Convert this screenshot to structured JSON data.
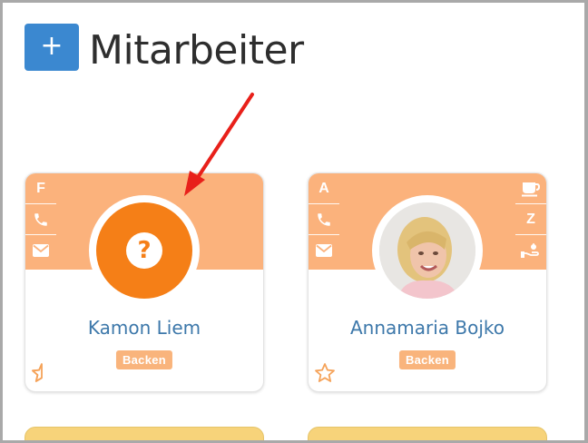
{
  "header": {
    "add_label": "+",
    "title": "Mitarbeiter"
  },
  "colors": {
    "accent_blue": "#3b88d0",
    "card_header": "#fbb27c",
    "avatar_unknown": "#f57f17",
    "badge": "#f9b47c",
    "name": "#3d78aa",
    "annotation_arrow": "#e8201a"
  },
  "employees": [
    {
      "name": "Kamon Liem",
      "department": "Backen",
      "avatar": "unknown-person-icon",
      "left_badges": [
        "F",
        "phone-icon",
        "mail-icon"
      ],
      "right_badges": []
    },
    {
      "name": "Annamaria Bojko",
      "department": "Backen",
      "avatar": "profile-photo",
      "left_badges": [
        "A",
        "phone-icon",
        "mail-icon"
      ],
      "right_badges": [
        "coffee-icon",
        "Z",
        "hand-icon"
      ]
    }
  ],
  "labels": {
    "card1_left_letter": "F",
    "card2_left_letter": "A",
    "card2_right_letter": "Z",
    "avatar_unknown_glyph": "?"
  }
}
